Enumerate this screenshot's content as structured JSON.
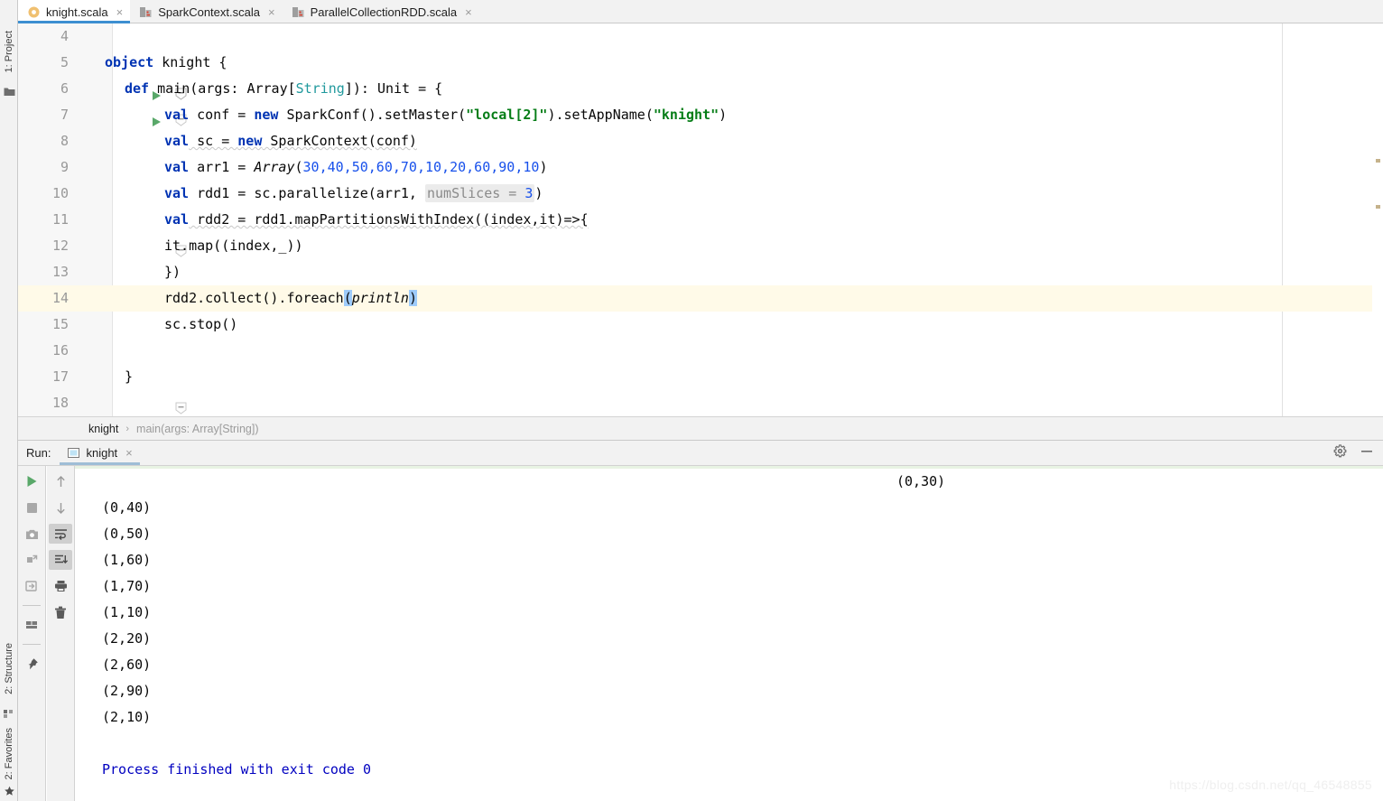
{
  "window": {
    "watermark": "https://blog.csdn.net/qq_46548855"
  },
  "left_strip": {
    "project_label": "1: Project",
    "structure_label": "2: Structure",
    "favorites_label": "2: Favorites",
    "project_icon": "folder-icon",
    "structure_icon": "structure-icon",
    "favorites_icon": "star-icon"
  },
  "tabs": [
    {
      "label": "knight.scala",
      "icon": "scala-object-icon",
      "active": true,
      "close": "×"
    },
    {
      "label": "SparkContext.scala",
      "icon": "scala-class-library-icon",
      "active": false,
      "close": "×"
    },
    {
      "label": "ParallelCollectionRDD.scala",
      "icon": "scala-class-library-icon",
      "active": false,
      "close": "×"
    }
  ],
  "editor": {
    "lines": [
      {
        "num": "4",
        "indent": 0,
        "run": false,
        "fold": "none"
      },
      {
        "num": "5",
        "indent": 0,
        "run": true,
        "fold": "collapse"
      },
      {
        "num": "6",
        "indent": 1,
        "run": true,
        "fold": "collapse"
      },
      {
        "num": "7",
        "indent": 2,
        "run": false,
        "fold": "none"
      },
      {
        "num": "8",
        "indent": 2,
        "run": false,
        "fold": "none"
      },
      {
        "num": "9",
        "indent": 2,
        "run": false,
        "fold": "none"
      },
      {
        "num": "10",
        "indent": 2,
        "run": false,
        "fold": "none"
      },
      {
        "num": "11",
        "indent": 2,
        "run": false,
        "fold": "collapse"
      },
      {
        "num": "12",
        "indent": 2,
        "run": false,
        "fold": "none"
      },
      {
        "num": "13",
        "indent": 2,
        "run": false,
        "fold": "collapse"
      },
      {
        "num": "14",
        "indent": 2,
        "run": false,
        "fold": "none"
      },
      {
        "num": "15",
        "indent": 2,
        "run": false,
        "fold": "none"
      },
      {
        "num": "16",
        "indent": 0,
        "run": false,
        "fold": "none"
      },
      {
        "num": "17",
        "indent": 1,
        "run": false,
        "fold": "none"
      },
      {
        "num": "18",
        "indent": 0,
        "run": false,
        "fold": "none"
      }
    ],
    "code": {
      "l4": "",
      "l5": "object knight {",
      "l6": "def main(args: Array[String]): Unit = {",
      "l7": "val conf = new SparkConf().setMaster(\"local[2]\").setAppName(\"knight\")",
      "l8": "val sc = new SparkContext(conf)",
      "l9": "val arr1 = Array(30,40,50,60,70,10,20,60,90,10)",
      "l10": "val rdd1 = sc.parallelize(arr1, numSlices = 3)",
      "l11": "val rdd2 = rdd1.mapPartitionsWithIndex((index,it)=>{",
      "l12": "it.map((index,_))",
      "l13": "})",
      "l14": "rdd2.collect().foreach(println)",
      "l15": "sc.stop()",
      "l16": "",
      "l17": "}",
      "l18": ""
    },
    "tokens": {
      "kw_object": "object",
      "name_knight": " knight {",
      "kw_def": "def",
      "def_rest1": " main(args: Array[",
      "type_String": "String",
      "def_rest2": "]): Unit = {",
      "kw_val": "val",
      "conf_a": " conf = ",
      "kw_new": "new",
      "conf_b": " SparkConf().setMaster(",
      "str_local": "\"local[2]\"",
      "conf_c": ").setAppName(",
      "str_knight": "\"knight\"",
      "conf_d": ")",
      "sc_a": " sc = ",
      "sc_b": " SparkContext(conf)",
      "arr_a": " arr1 = ",
      "arr_fn": "Array",
      "arr_open": "(",
      "arr_nums": "30,40,50,60,70,10,20,60,90,10",
      "arr_close": ")",
      "rdd1_a": " rdd1 = sc.parallelize(arr1, ",
      "hint_numslices": "numSlices = ",
      "hint_val": "3",
      "rdd1_close": ")",
      "rdd2_a": " rdd2 = rdd1.mapPartitionsWithIndex((index,it)=>{",
      "itmap": "it.map((index,_))",
      "closebrace": "})",
      "collect_a": "rdd2.collect().foreach",
      "paren_open": "(",
      "println": "println",
      "paren_close": ")",
      "scstop": "sc.stop()",
      "brace_close": "}"
    }
  },
  "breadcrumb": {
    "current": "knight",
    "separator": "›",
    "next": "main(args: Array[String])"
  },
  "run_panel": {
    "run_label": "Run:",
    "tab_label": "knight",
    "tab_icon": "run-config-icon",
    "tab_close": "×",
    "settings_icon": "gear-icon",
    "minimize_icon": "minimize-icon",
    "toolbar_left": [
      {
        "name": "rerun-button",
        "icon": "play-icon"
      },
      {
        "name": "stop-button",
        "icon": "stop-square-icon"
      },
      {
        "name": "screenshot-button",
        "icon": "camera-icon"
      },
      {
        "name": "dump-threads-button",
        "icon": "thread-dump-icon"
      },
      {
        "name": "restore-layout-button",
        "icon": "restore-layout-icon"
      },
      {
        "name": "layout-settings-button",
        "icon": "layout-icon"
      },
      {
        "name": "pin-tab-button",
        "icon": "pin-icon"
      }
    ],
    "toolbar_right": [
      {
        "name": "scroll-up-button",
        "icon": "arrow-up-icon",
        "pressed": false
      },
      {
        "name": "scroll-down-button",
        "icon": "arrow-down-icon",
        "pressed": false
      },
      {
        "name": "soft-wrap-button",
        "icon": "soft-wrap-icon",
        "pressed": true
      },
      {
        "name": "scroll-to-end-button",
        "icon": "scroll-end-icon",
        "pressed": true
      },
      {
        "name": "print-button",
        "icon": "printer-icon",
        "pressed": false
      },
      {
        "name": "clear-all-button",
        "icon": "trash-icon",
        "pressed": false
      }
    ],
    "console": {
      "lines": [
        {
          "text": "(0,30)",
          "indent": 890,
          "style": "plain"
        },
        {
          "text": "(0,40)",
          "indent": 0,
          "style": "plain"
        },
        {
          "text": "(0,50)",
          "indent": 0,
          "style": "plain"
        },
        {
          "text": "(1,60)",
          "indent": 0,
          "style": "plain"
        },
        {
          "text": "(1,70)",
          "indent": 0,
          "style": "plain"
        },
        {
          "text": "(1,10)",
          "indent": 0,
          "style": "plain"
        },
        {
          "text": "(2,20)",
          "indent": 0,
          "style": "plain"
        },
        {
          "text": "(2,60)",
          "indent": 0,
          "style": "plain"
        },
        {
          "text": "(2,90)",
          "indent": 0,
          "style": "plain"
        },
        {
          "text": "(2,10)",
          "indent": 0,
          "style": "plain"
        },
        {
          "text": "",
          "indent": 0,
          "style": "plain"
        },
        {
          "text": "Process finished with exit code 0",
          "indent": 0,
          "style": "blue"
        }
      ]
    }
  },
  "colors": {
    "keyword": "#0033b3",
    "string": "#067d17",
    "number": "#1750eb",
    "type": "#20999d",
    "caret_row": "#fffae8",
    "paren_highlight": "#9ecbfa",
    "tab_accent": "#3d8fd1",
    "console_blue": "#0000c0"
  }
}
